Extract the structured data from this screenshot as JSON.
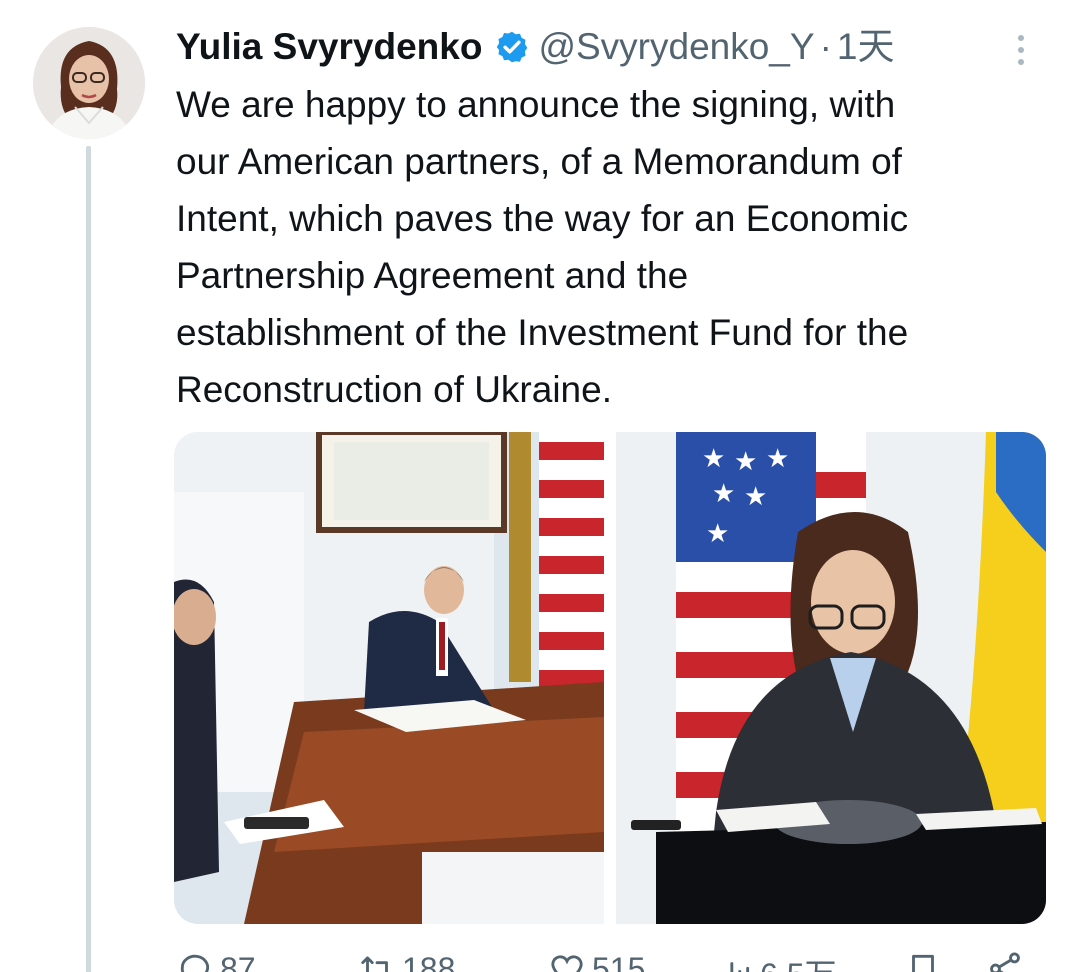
{
  "tweet": {
    "author_name": "Yulia Svyrydenko",
    "handle": "@Svyrydenko_Y",
    "separator": "·",
    "time": "1天",
    "text_lines": [
      "We are happy to announce the signing, with",
      "our American partners, of a Memorandum of",
      "Intent, which paves the way for an Economic",
      "Partnership Agreement and the",
      "establishment of the Investment Fund for the",
      "Reconstruction of Ukraine."
    ]
  },
  "media": {
    "photos": [
      {
        "subject": "signing-photo-us-side"
      },
      {
        "subject": "signing-photo-ukraine-side"
      }
    ]
  },
  "actions": {
    "reply_count": "87",
    "retweet_count": "188",
    "like_count": "515",
    "views_count": "6.5万"
  },
  "icons": {
    "verified": "verified-badge-icon",
    "more": "more-vertical-icon",
    "reply": "reply-icon",
    "retweet": "retweet-icon",
    "like": "like-icon",
    "views": "views-icon",
    "bookmark": "bookmark-icon",
    "share": "share-icon"
  },
  "colors": {
    "verified_blue": "#1d9bf0",
    "text_primary": "#0f1419",
    "text_secondary": "#536471",
    "thread_line": "#cfd9de"
  }
}
